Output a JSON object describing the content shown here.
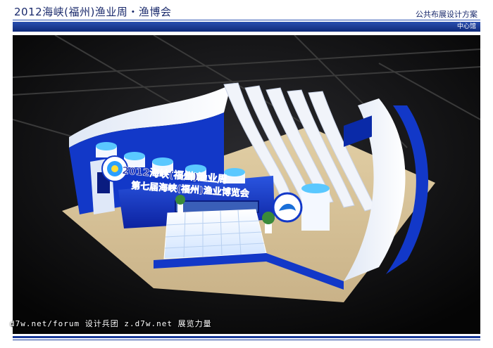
{
  "header": {
    "title": "2012海峡(福州)渔业周・渔博会",
    "subtitle": "公共布展设计方案",
    "badge": "中心馆"
  },
  "booth": {
    "sign_line1": "2012海峡(福州)渔业周",
    "sign_line2": "第七届海峡(福州)渔业博览会"
  },
  "watermark": "d7w.net/forum 设计兵团 z.d7w.net 展览力量",
  "colors": {
    "accent_blue": "#1a3a9a",
    "booth_blue": "#1238c8",
    "floor": "#d8c49a"
  }
}
